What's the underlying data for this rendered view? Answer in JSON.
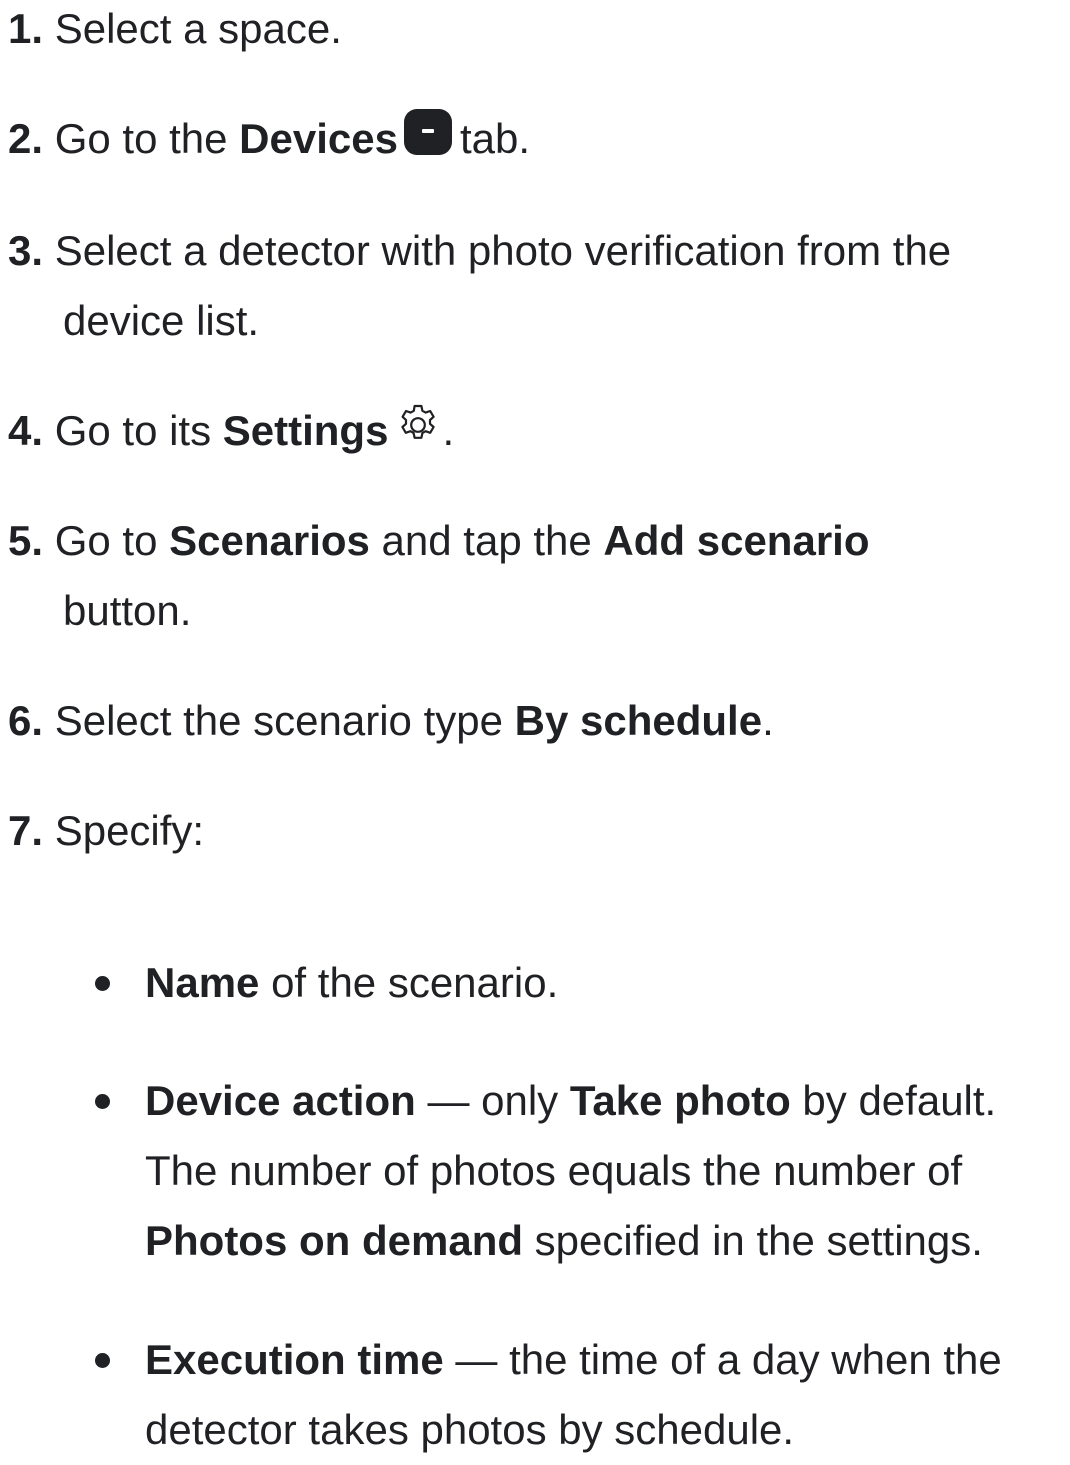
{
  "steps": [
    {
      "num": "1.",
      "parts": [
        {
          "t": "Select a space."
        }
      ]
    },
    {
      "num": "2.",
      "parts": [
        {
          "t": "Go to the "
        },
        {
          "t": "Devices",
          "b": true
        },
        {
          "icon": "devices-tab-icon"
        },
        {
          "t": "tab."
        }
      ]
    },
    {
      "num": "3.",
      "parts": [
        {
          "t": "Select a detector with photo verification from the"
        }
      ],
      "cont": "device list."
    },
    {
      "num": "4.",
      "parts": [
        {
          "t": "Go to its "
        },
        {
          "t": "Settings",
          "b": true
        },
        {
          "icon": "gear-icon"
        },
        {
          "t": "."
        }
      ]
    },
    {
      "num": "5.",
      "parts": [
        {
          "t": "Go to "
        },
        {
          "t": "Scenarios",
          "b": true
        },
        {
          "t": " and tap the "
        },
        {
          "t": "Add scenario",
          "b": true
        }
      ],
      "cont": "button."
    },
    {
      "num": "6.",
      "parts": [
        {
          "t": "Select the scenario type "
        },
        {
          "t": "By schedule",
          "b": true
        },
        {
          "t": "."
        }
      ]
    },
    {
      "num": "7.",
      "parts": [
        {
          "t": "Specify:"
        }
      ]
    }
  ],
  "bullets": [
    {
      "lines": [
        [
          {
            "t": "Name",
            "b": true
          },
          {
            "t": " of the scenario."
          }
        ]
      ]
    },
    {
      "lines": [
        [
          {
            "t": "Device action",
            "b": true
          },
          {
            "t": " — only "
          },
          {
            "t": "Take photo",
            "b": true
          },
          {
            "t": " by default."
          }
        ],
        [
          {
            "t": "The number of photos equals the number of"
          }
        ],
        [
          {
            "t": "Photos on demand",
            "b": true
          },
          {
            "t": " specified in the settings."
          }
        ]
      ]
    },
    {
      "lines": [
        [
          {
            "t": "Execution time",
            "b": true
          },
          {
            "t": " — the time of a day when the"
          }
        ],
        [
          {
            "t": "detector takes photos by schedule."
          }
        ]
      ]
    }
  ]
}
